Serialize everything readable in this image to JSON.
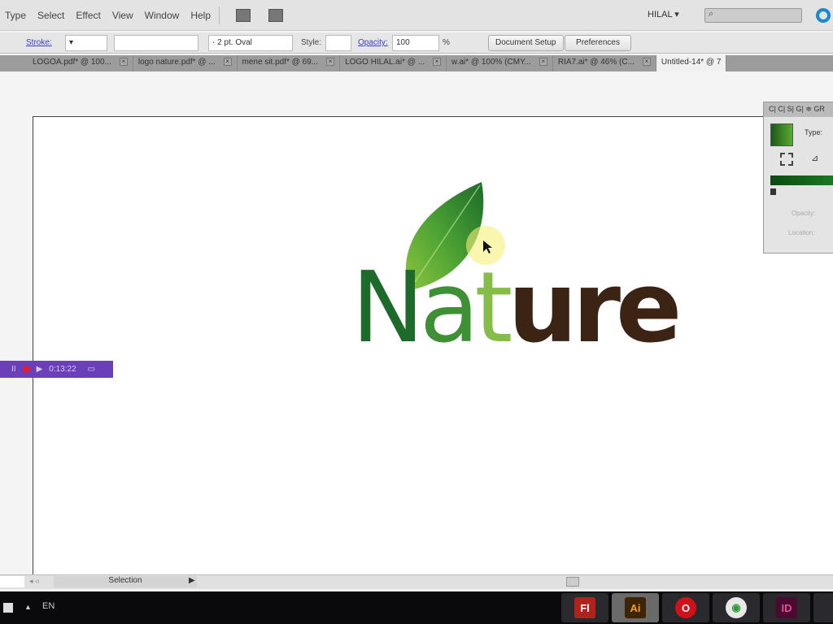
{
  "menu": [
    "Type",
    "Select",
    "Effect",
    "View",
    "Window",
    "Help"
  ],
  "workspace": "HILAL",
  "control": {
    "stroke_label": "Stroke:",
    "brush": "2 pt. Oval",
    "style_label": "Style:",
    "opacity_label": "Opacity:",
    "opacity": "100",
    "percent": "%",
    "doc_setup": "Document Setup",
    "preferences": "Preferences"
  },
  "tabs": [
    "LOGOA.pdf* @ 100...",
    "logo nature.pdf* @ ...",
    "mene sit.pdf* @ 69...",
    "LOGO HILAL.ai* @ ...",
    "w.ai* @ 100% (CMY...",
    "RIA7.ai* @ 46% (C...",
    "Untitled-14* @ 7"
  ],
  "gradient_panel": {
    "tabs": "C| C| S| G| ≑ GR",
    "type_label": "Type:",
    "opacity_label": "Opacity:",
    "location_label": "Location:"
  },
  "logo": {
    "letters": [
      "N",
      "a",
      "t",
      "u",
      "r",
      "e"
    ],
    "colors": [
      "#1d6a2b",
      "#3f8f34",
      "#86bd4a",
      "#3b2414",
      "#3b2414",
      "#3b2414"
    ]
  },
  "recorder": {
    "time": "0:13:22",
    "pause": "II"
  },
  "status": {
    "tool": "Selection"
  },
  "taskbar": {
    "lang": "EN",
    "apps": [
      {
        "name": "Fl",
        "bg": "#b0231c",
        "fg": "#fff"
      },
      {
        "name": "Ai",
        "bg": "#3d2405",
        "fg": "#f5a020"
      },
      {
        "name": "O",
        "bg": "#d0101a",
        "fg": "#fff"
      },
      {
        "name": "◉",
        "bg": "#e8e8e8",
        "fg": "#2f9a3a"
      },
      {
        "name": "ID",
        "bg": "#4a0b2f",
        "fg": "#e64fa0"
      }
    ]
  }
}
